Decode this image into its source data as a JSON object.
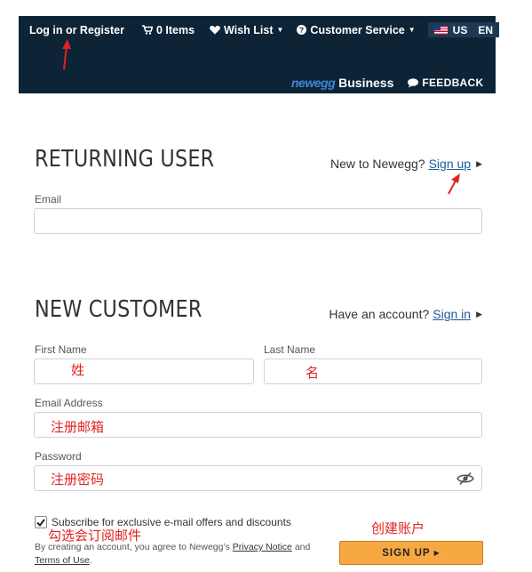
{
  "header": {
    "login": "Log in or Register",
    "cart": "0 Items",
    "wishlist": "Wish List",
    "customer_service": "Customer Service",
    "country": "US",
    "language": "EN",
    "brand_logo": "newegg",
    "brand_business": "Business",
    "feedback": "FEEDBACK"
  },
  "returning": {
    "title": "RETURNING USER",
    "new_prompt": "New to Newegg?",
    "signup_link": "Sign up",
    "email_label": "Email"
  },
  "new_customer": {
    "title": "NEW CUSTOMER",
    "have_account": "Have an account?",
    "signin_link": "Sign in",
    "first_name_label": "First Name",
    "last_name_label": "Last Name",
    "email_label": "Email Address",
    "password_label": "Password",
    "subscribe_label": "Subscribe for exclusive e-mail offers and discounts",
    "subscribe_checked": true,
    "terms_prefix": "By creating an account, you agree to Newegg’s",
    "privacy_link": "Privacy Notice",
    "terms_and": "and",
    "terms_link": "Terms of Use",
    "terms_suffix": ".",
    "signup_button": "SIGN UP"
  },
  "annotations": {
    "first_name": "姓",
    "last_name": "名",
    "email": "注册邮箱",
    "password": "注册密码",
    "subscribe": "勾选会订阅邮件",
    "create_account": "创建账户"
  },
  "colors": {
    "header_bg": "#0d2437",
    "accent_button": "#f7a941",
    "annotation": "#e32222",
    "link": "#1e5b9a"
  }
}
